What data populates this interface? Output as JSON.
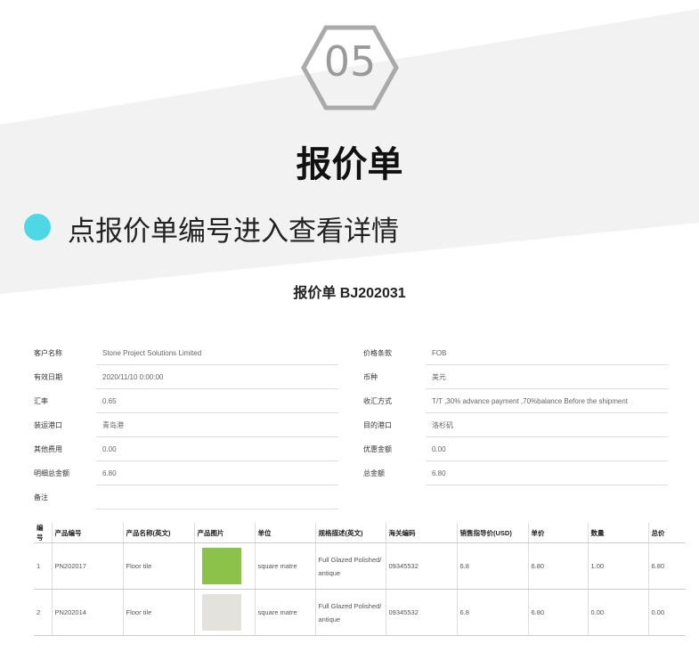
{
  "header": {
    "step_number": "05",
    "title": "报价单",
    "bullet_text": "点报价单编号进入查看详情",
    "accent": "#4ed8e6"
  },
  "quote": {
    "title": "报价单 BJ202031",
    "left_fields": [
      {
        "label": "客户名称",
        "value": "Stone Project Solutions Limited"
      },
      {
        "label": "有效日期",
        "value": "2020/11/10 0:00:00"
      },
      {
        "label": "汇率",
        "value": "0.65"
      },
      {
        "label": "装运港口",
        "value": "青岛港"
      },
      {
        "label": "其他费用",
        "value": "0.00"
      },
      {
        "label": "明细总金额",
        "value": "6.80"
      },
      {
        "label": "备注",
        "value": ""
      }
    ],
    "right_fields": [
      {
        "label": "价格条款",
        "value": "FOB"
      },
      {
        "label": "币种",
        "value": "美元"
      },
      {
        "label": "收汇方式",
        "value": "T/T ,30% advance payment ,70%balance Before the shipment"
      },
      {
        "label": "目的港口",
        "value": "洛杉矶"
      },
      {
        "label": "优惠金额",
        "value": "0.00"
      },
      {
        "label": "总金额",
        "value": "6.80"
      }
    ]
  },
  "table": {
    "headers": [
      "编号",
      "产品编号",
      "产品名称(英文)",
      "产品图片",
      "单位",
      "规格描述(英文)",
      "海关编码",
      "销售指导价(USD)",
      "单价",
      "数量",
      "总价"
    ],
    "rows": [
      {
        "no": "1",
        "code": "PN202017",
        "name": "Floor tile",
        "image_color": "#8bc34a",
        "unit": "square matre",
        "spec": "Full Glazed Polished/ antique",
        "hs": "09345532",
        "guide": "6.8",
        "price": "6.80",
        "qty": "1.00",
        "total": "6.80"
      },
      {
        "no": "2",
        "code": "PN202014",
        "name": "Floor tile",
        "image_color": "#e4e2dc",
        "unit": "square matre",
        "spec": "Full Glazed Polished/ antique",
        "hs": "09345532",
        "guide": "6.8",
        "price": "6.80",
        "qty": "0.00",
        "total": "0.00"
      }
    ]
  }
}
